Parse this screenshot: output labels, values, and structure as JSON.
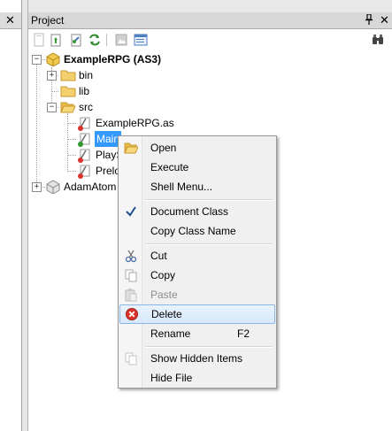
{
  "left_panel": {
    "close_symbol": "✕"
  },
  "project_panel": {
    "title": "Project",
    "pin_symbol": "📌",
    "close_symbol": "✕",
    "toolbar": {
      "buttons": [
        {
          "icon": "new-file-icon"
        },
        {
          "icon": "open-file-icon"
        },
        {
          "icon": "build-icon"
        },
        {
          "icon": "refresh-icon"
        },
        {
          "icon": "image-icon"
        },
        {
          "icon": "properties-icon"
        },
        {
          "icon": "binoculars-icon"
        }
      ]
    },
    "tree": {
      "root": {
        "label": "ExampleRPG (AS3)",
        "expander": "−"
      },
      "bin": {
        "label": "bin",
        "expander": "+"
      },
      "lib": {
        "label": "lib"
      },
      "src": {
        "label": "src",
        "expander": "−"
      },
      "file1": {
        "label": "ExampleRPG.as"
      },
      "file2": {
        "label": "Main"
      },
      "file3": {
        "label": "PlayS"
      },
      "file4": {
        "label": "Prelo"
      },
      "lib2": {
        "label": "AdamAtom",
        "expander": "+"
      }
    }
  },
  "context_menu": {
    "items": [
      {
        "label": "Open",
        "icon": "open-folder-icon"
      },
      {
        "label": "Execute"
      },
      {
        "label": "Shell Menu..."
      },
      {
        "label": "Document Class",
        "icon": "checkmark-icon"
      },
      {
        "label": "Copy Class Name"
      },
      {
        "label": "Cut",
        "icon": "scissors-icon"
      },
      {
        "label": "Copy",
        "icon": "copy-icon"
      },
      {
        "label": "Paste",
        "icon": "paste-icon",
        "disabled": true
      },
      {
        "label": "Delete",
        "icon": "delete-icon",
        "highlighted": true
      },
      {
        "label": "Rename",
        "shortcut": "F2"
      },
      {
        "label": "Show Hidden Items",
        "icon": "hidden-items-icon"
      },
      {
        "label": "Hide File"
      }
    ]
  },
  "colors": {
    "selection": "#3399ff",
    "menu_hover": "#d6e8fb",
    "folder": "#f4cf6e",
    "delete_red": "#d9342b"
  }
}
